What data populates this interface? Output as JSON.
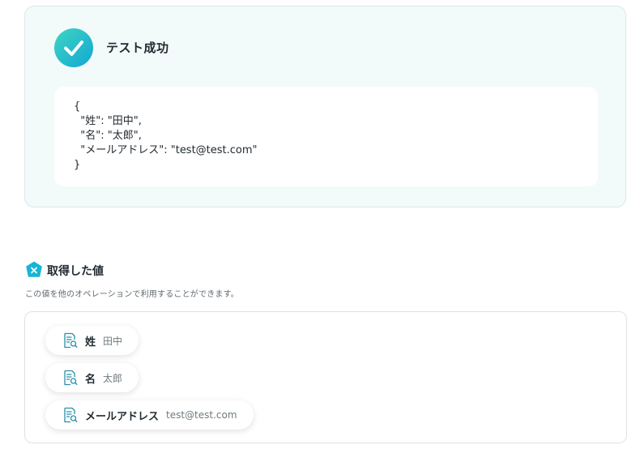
{
  "result": {
    "status_icon": "check-circle-icon",
    "title": "テスト成功",
    "json_output": "{\n  \"姓\": \"田中\",\n  \"名\": \"太郎\",\n  \"メールアドレス\": \"test@test.com\"\n}"
  },
  "retrieved": {
    "section_icon": "variable-badge-icon",
    "title": "取得した値",
    "description": "この値を他のオペレーションで利用することができます。",
    "items": [
      {
        "icon": "document-search-icon",
        "label": "姓",
        "value": "田中"
      },
      {
        "icon": "document-search-icon",
        "label": "名",
        "value": "太郎"
      },
      {
        "icon": "document-search-icon",
        "label": "メールアドレス",
        "value": "test@test.com"
      }
    ]
  },
  "colors": {
    "success_gradient_start": "#3fd5c1",
    "success_gradient_end": "#12a7d4",
    "panel_background": "#f2fafa",
    "accent": "#18b4d6"
  }
}
